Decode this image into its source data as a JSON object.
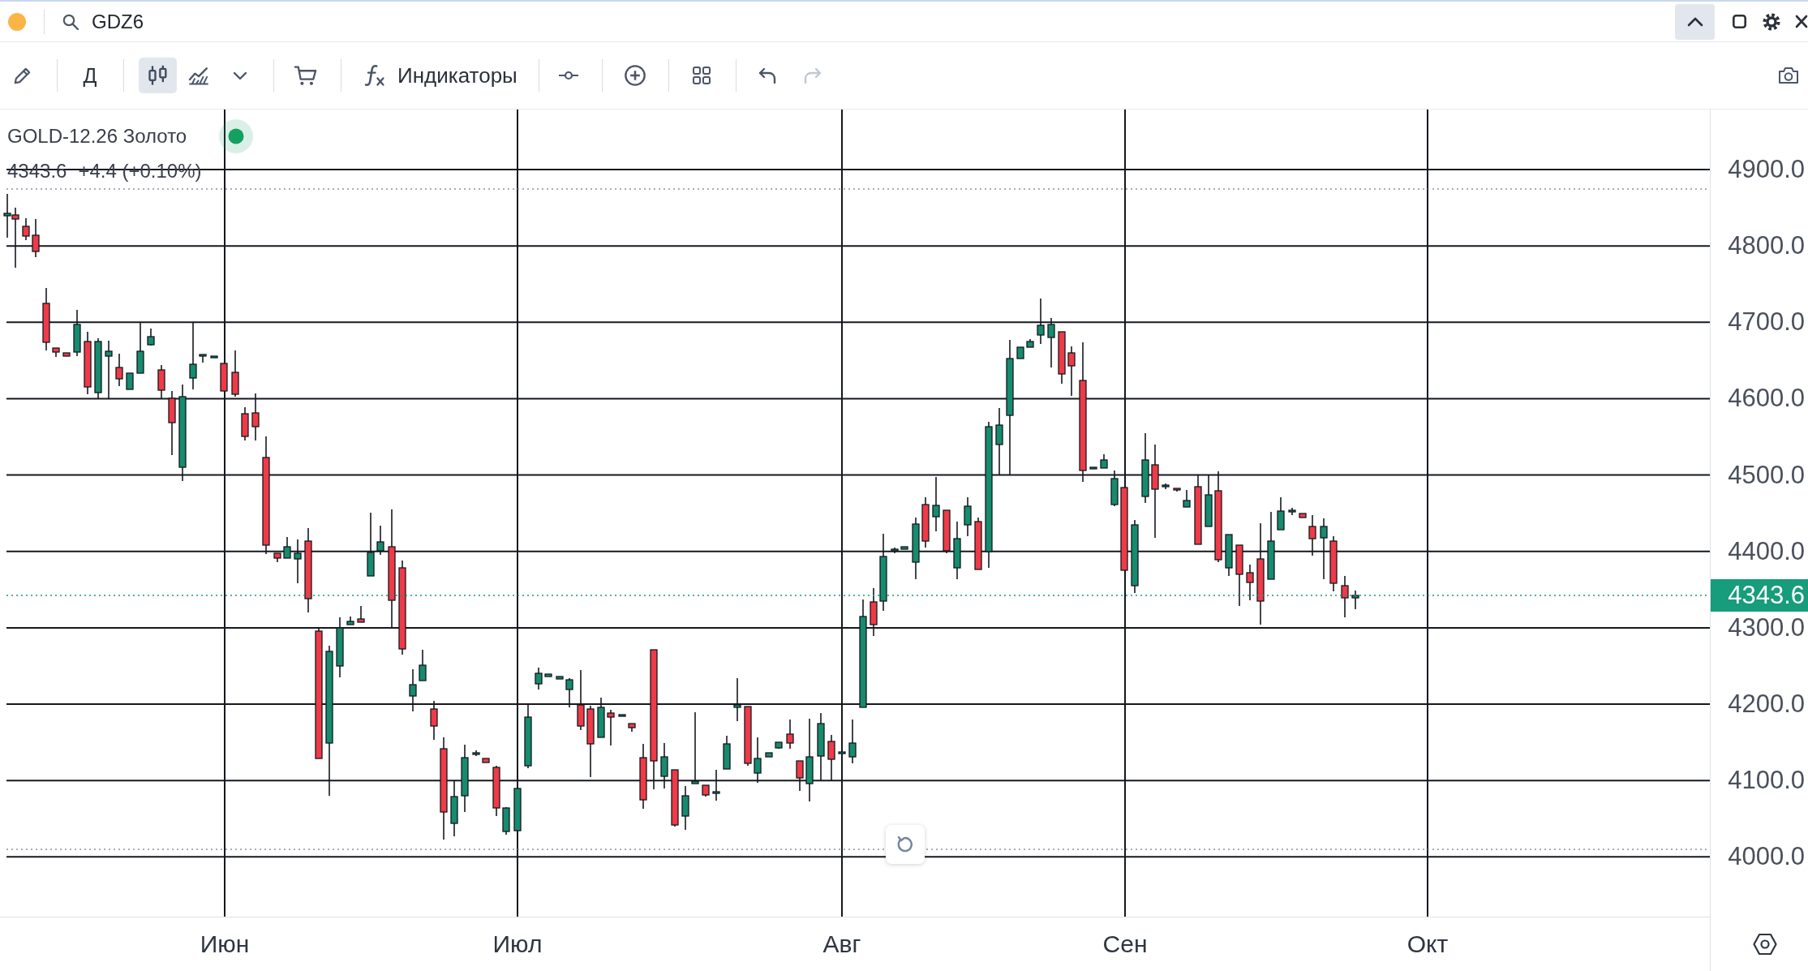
{
  "header": {
    "search": {
      "value": "GDZ6"
    }
  },
  "toolbar": {
    "interval": {
      "label": "Д"
    },
    "chart_types": [
      {
        "kind": "candles",
        "selected": true
      },
      {
        "kind": "area",
        "selected": false
      }
    ],
    "indicators": {
      "label": "Индикаторы"
    },
    "history": [
      {
        "kind": "undo",
        "disabled": false
      },
      {
        "kind": "redo",
        "disabled": true
      }
    ]
  },
  "legend": {
    "title": "GOLD-12.26 Золото",
    "price": "4343.6",
    "change": "+4.4 (+0.10%)"
  },
  "price_axis": {
    "labels": [
      "4900.0",
      "4800.0",
      "4700.0",
      "4600.0",
      "4500.0",
      "4400.0",
      "4300.0",
      "4200.0",
      "4100.0",
      "4000.0"
    ],
    "current_price": "4343.6"
  },
  "time_axis": {
    "labels": [
      "Июн",
      "Июл",
      "Авг",
      "Сен",
      "Окт"
    ]
  }
}
